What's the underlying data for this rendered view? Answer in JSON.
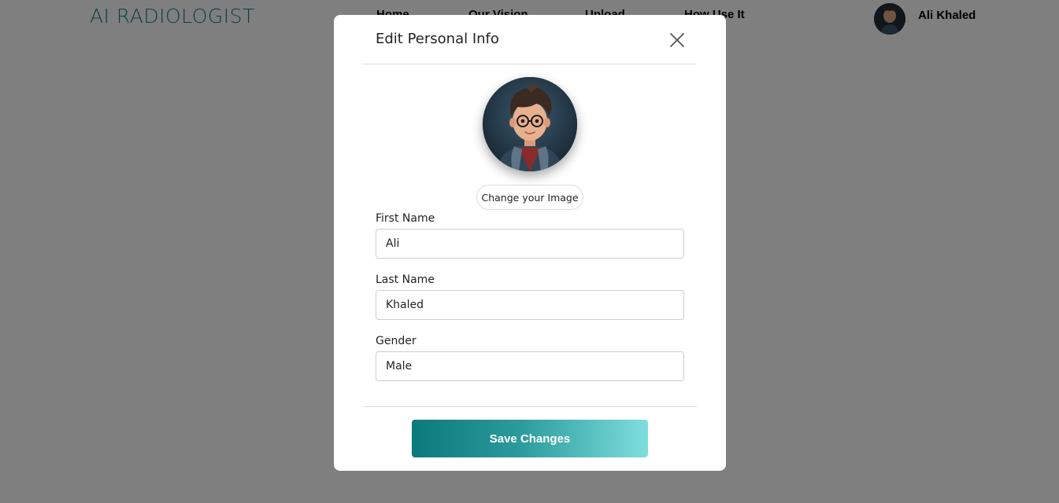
{
  "brand": {
    "logo_text": "AI RADIOLOGIST",
    "accent": "#1f7f86"
  },
  "nav": {
    "links": [
      "Home",
      "Our Vision",
      "Upload",
      "How Use It"
    ],
    "user_name": "Ali Khaled"
  },
  "modal": {
    "title": "Edit Personal Info",
    "close_icon": "close-icon",
    "change_image_label": "Change your Image",
    "fields": [
      {
        "label": "First Name",
        "value": "Ali"
      },
      {
        "label": "Last Name",
        "value": "Khaled"
      },
      {
        "label": "Gender",
        "value": "Male"
      }
    ],
    "save_label": "Save Changes",
    "save_gradient": [
      "#0b7a7c",
      "#7fdedd"
    ]
  },
  "overlay_color": "#808080"
}
